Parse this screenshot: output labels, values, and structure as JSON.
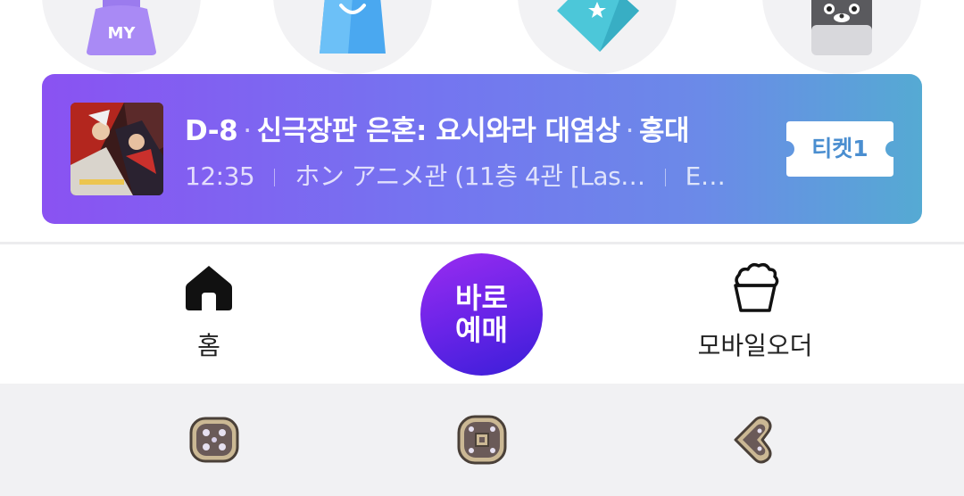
{
  "shortcuts": [
    {
      "name": "my-page",
      "icon": "my-bag-icon",
      "label": "MY"
    },
    {
      "name": "store",
      "icon": "shopping-bag-icon"
    },
    {
      "name": "benefits",
      "icon": "star-tag-icon"
    },
    {
      "name": "mascot",
      "icon": "cat-mascot-icon"
    }
  ],
  "ticket": {
    "dday": "D-8",
    "movie": "신극장판 은혼: 요시와라 대염상",
    "theater": "홍대",
    "time": "12:35",
    "hall": "ホン アニメ관 (11층 4관 [Las…",
    "extra": "E…",
    "button_label": "티켓1",
    "gradient": [
      "#8a52f2",
      "#7475f0",
      "#55aad3"
    ]
  },
  "bottom_nav": {
    "home_label": "홈",
    "quick_book_line1": "바로",
    "quick_book_line2": "예매",
    "mobile_order_label": "모바일오더"
  },
  "colors": {
    "accent_purple": "#7b2cf0",
    "ticket_text": "#4a8ed0"
  },
  "system_nav": {
    "buttons": [
      "recent-apps-icon",
      "home-icon",
      "back-icon"
    ]
  }
}
